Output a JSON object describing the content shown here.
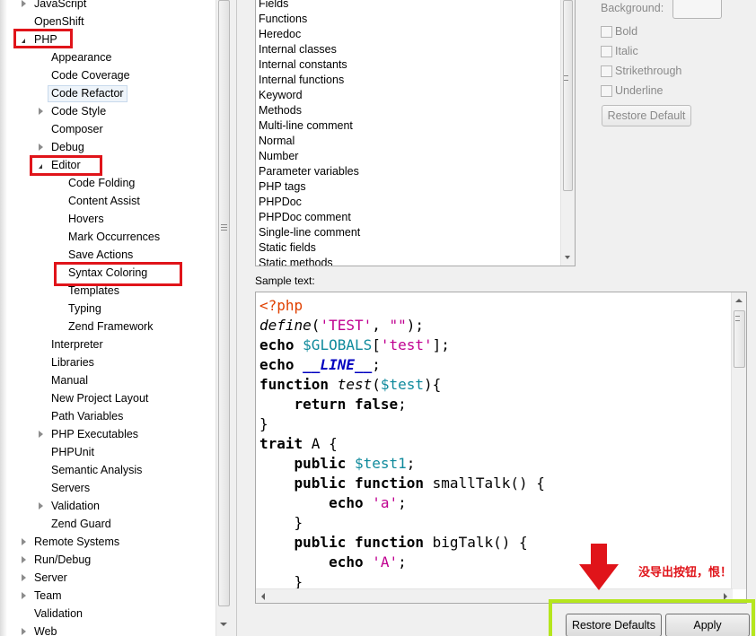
{
  "tree": {
    "items": [
      {
        "label": "JavaScript",
        "toggle": "collapsed",
        "indent": 0
      },
      {
        "label": "OpenShift",
        "toggle": "none",
        "indent": 0
      },
      {
        "label": "PHP",
        "toggle": "expanded",
        "indent": 0
      },
      {
        "label": "Appearance",
        "toggle": "none",
        "indent": 1
      },
      {
        "label": "Code Coverage",
        "toggle": "none",
        "indent": 1
      },
      {
        "label": "Code Refactor",
        "toggle": "none",
        "indent": 1,
        "selected": true
      },
      {
        "label": "Code Style",
        "toggle": "collapsed",
        "indent": 1
      },
      {
        "label": "Composer",
        "toggle": "none",
        "indent": 1
      },
      {
        "label": "Debug",
        "toggle": "collapsed",
        "indent": 1
      },
      {
        "label": "Editor",
        "toggle": "expanded",
        "indent": 1
      },
      {
        "label": "Code Folding",
        "toggle": "none",
        "indent": 2
      },
      {
        "label": "Content Assist",
        "toggle": "none",
        "indent": 2
      },
      {
        "label": "Hovers",
        "toggle": "none",
        "indent": 2
      },
      {
        "label": "Mark Occurrences",
        "toggle": "none",
        "indent": 2
      },
      {
        "label": "Save Actions",
        "toggle": "none",
        "indent": 2
      },
      {
        "label": "Syntax Coloring",
        "toggle": "none",
        "indent": 2
      },
      {
        "label": "Templates",
        "toggle": "none",
        "indent": 2
      },
      {
        "label": "Typing",
        "toggle": "none",
        "indent": 2
      },
      {
        "label": "Zend Framework",
        "toggle": "none",
        "indent": 2
      },
      {
        "label": "Interpreter",
        "toggle": "none",
        "indent": 1
      },
      {
        "label": "Libraries",
        "toggle": "none",
        "indent": 1
      },
      {
        "label": "Manual",
        "toggle": "none",
        "indent": 1
      },
      {
        "label": "New Project Layout",
        "toggle": "none",
        "indent": 1
      },
      {
        "label": "Path Variables",
        "toggle": "none",
        "indent": 1
      },
      {
        "label": "PHP Executables",
        "toggle": "collapsed",
        "indent": 1
      },
      {
        "label": "PHPUnit",
        "toggle": "none",
        "indent": 1
      },
      {
        "label": "Semantic Analysis",
        "toggle": "none",
        "indent": 1
      },
      {
        "label": "Servers",
        "toggle": "none",
        "indent": 1
      },
      {
        "label": "Validation",
        "toggle": "collapsed",
        "indent": 1
      },
      {
        "label": "Zend Guard",
        "toggle": "none",
        "indent": 1
      },
      {
        "label": "Remote Systems",
        "toggle": "collapsed",
        "indent": 0
      },
      {
        "label": "Run/Debug",
        "toggle": "collapsed",
        "indent": 0
      },
      {
        "label": "Server",
        "toggle": "collapsed",
        "indent": 0
      },
      {
        "label": "Team",
        "toggle": "collapsed",
        "indent": 0
      },
      {
        "label": "Validation",
        "toggle": "none",
        "indent": 0
      },
      {
        "label": "Web",
        "toggle": "collapsed",
        "indent": 0
      }
    ]
  },
  "elements": [
    "Fields",
    "Functions",
    "Heredoc",
    "Internal classes",
    "Internal constants",
    "Internal functions",
    "Keyword",
    "Methods",
    "Multi-line comment",
    "Normal",
    "Number",
    "Parameter variables",
    "PHP tags",
    "PHPDoc",
    "PHPDoc comment",
    "Single-line comment",
    "Static fields",
    "Static methods"
  ],
  "style_options": {
    "background_label": "Background:",
    "bold": "Bold",
    "italic": "Italic",
    "strikethrough": "Strikethrough",
    "underline": "Underline",
    "restore_default": "Restore Default"
  },
  "sample": {
    "label": "Sample text:",
    "lines": [
      [
        {
          "t": "<?php",
          "c": "tag"
        }
      ],
      [
        {
          "t": "define",
          "c": "it"
        },
        {
          "t": "("
        },
        {
          "t": "'TEST'",
          "c": "str"
        },
        {
          "t": ", "
        },
        {
          "t": "\"\"",
          "c": "str"
        },
        {
          "t": ");"
        }
      ],
      [
        {
          "t": "echo",
          "c": "kw"
        },
        {
          "t": " "
        },
        {
          "t": "$GLOBALS",
          "c": "var"
        },
        {
          "t": "["
        },
        {
          "t": "'test'",
          "c": "str"
        },
        {
          "t": "];"
        }
      ],
      [
        {
          "t": "echo",
          "c": "kw"
        },
        {
          "t": " "
        },
        {
          "t": "__LINE__",
          "c": "kw2"
        },
        {
          "t": ";"
        }
      ],
      [
        {
          "t": "function",
          "c": "kw"
        },
        {
          "t": " "
        },
        {
          "t": "test",
          "c": "it"
        },
        {
          "t": "("
        },
        {
          "t": "$test",
          "c": "var"
        },
        {
          "t": "){"
        }
      ],
      [
        {
          "t": "    "
        },
        {
          "t": "return",
          "c": "kw"
        },
        {
          "t": " "
        },
        {
          "t": "false",
          "c": "kw"
        },
        {
          "t": ";"
        }
      ],
      [
        {
          "t": "}"
        }
      ],
      [
        {
          "t": "trait",
          "c": "kw"
        },
        {
          "t": " A {"
        }
      ],
      [
        {
          "t": "    "
        },
        {
          "t": "public",
          "c": "kw"
        },
        {
          "t": " "
        },
        {
          "t": "$test1",
          "c": "var"
        },
        {
          "t": ";"
        }
      ],
      [
        {
          "t": "    "
        },
        {
          "t": "public",
          "c": "kw"
        },
        {
          "t": " "
        },
        {
          "t": "function",
          "c": "kw"
        },
        {
          "t": " smallTalk() {"
        }
      ],
      [
        {
          "t": "        "
        },
        {
          "t": "echo",
          "c": "kw"
        },
        {
          "t": " "
        },
        {
          "t": "'a'",
          "c": "str"
        },
        {
          "t": ";"
        }
      ],
      [
        {
          "t": "    }"
        }
      ],
      [
        {
          "t": "    "
        },
        {
          "t": "public",
          "c": "kw"
        },
        {
          "t": " "
        },
        {
          "t": "function",
          "c": "kw"
        },
        {
          "t": " bigTalk() {"
        }
      ],
      [
        {
          "t": "        "
        },
        {
          "t": "echo",
          "c": "kw"
        },
        {
          "t": " "
        },
        {
          "t": "'A'",
          "c": "str"
        },
        {
          "t": ";"
        }
      ],
      [
        {
          "t": "    }"
        }
      ]
    ]
  },
  "buttons": {
    "restore_defaults": "Restore Defaults",
    "apply": "Apply"
  },
  "annotation": {
    "text": "没导出按钮，恨！",
    "color": "#e0141a"
  },
  "colors": {
    "highlight_red": "#e0141a",
    "highlight_green": "#b5e61d"
  }
}
